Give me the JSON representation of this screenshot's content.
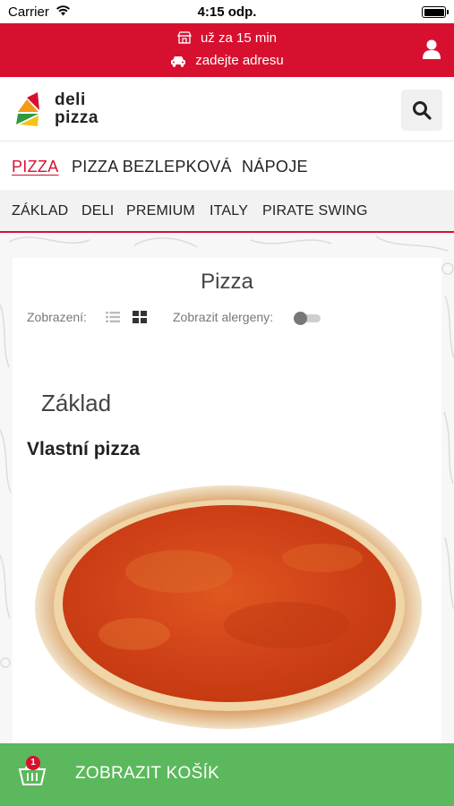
{
  "status_bar": {
    "carrier": "Carrier",
    "time": "4:15 odp."
  },
  "info_bar": {
    "delivery_time": "už za 15 min",
    "address_prompt": "zadejte adresu"
  },
  "brand": {
    "line1": "deli",
    "line2": "pizza",
    "accent": "#d8102f"
  },
  "categories": [
    {
      "label": "PIZZA",
      "active": true
    },
    {
      "label": "PIZZA BEZLEPKOVÁ",
      "active": false
    },
    {
      "label": "NÁPOJE",
      "active": false
    }
  ],
  "subcategories": [
    {
      "label": "ZÁKLAD"
    },
    {
      "label": "DELI"
    },
    {
      "label": "PREMIUM"
    },
    {
      "label": "ITALY"
    },
    {
      "label": "PIRATE SWING"
    }
  ],
  "page": {
    "title": "Pizza",
    "view_label": "Zobrazení:",
    "allergen_label": "Zobrazit alergeny:",
    "allergen_toggle_on": false,
    "section_title": "Základ",
    "product_name": "Vlastní pizza"
  },
  "cart": {
    "label": "ZOBRAZIT KOŠÍK",
    "count": "1",
    "color": "#5cb85c"
  },
  "icons": [
    "wifi-icon",
    "battery-icon",
    "store-icon",
    "car-icon",
    "user-icon",
    "search-icon",
    "list-view-icon",
    "grid-view-icon",
    "basket-icon"
  ]
}
